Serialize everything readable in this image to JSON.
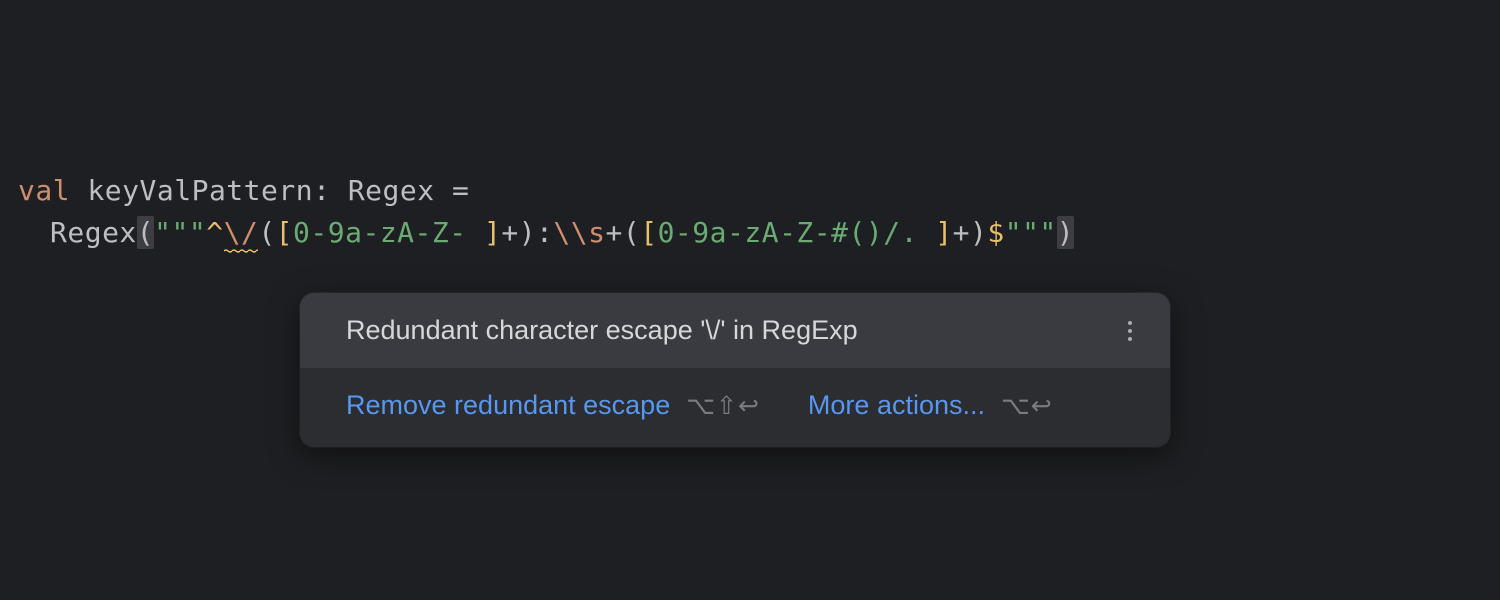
{
  "code": {
    "line1": {
      "keyword": "val",
      "identifier": "keyValPattern",
      "colon": ":",
      "type": "Regex",
      "eq": "="
    },
    "line2": {
      "func": "Regex",
      "open_paren": "(",
      "triple_quote_open": "\"\"\"",
      "caret": "^",
      "escape_slash": "\\/",
      "group1_open": "(",
      "class1_open": "[",
      "class1_content": "0-9a-zA-Z- ",
      "class1_close": "]",
      "plus1": "+",
      "group1_close": ")",
      "literal_colon": ":",
      "escape_s": "\\\\s",
      "plus2": "+",
      "group2_open": "(",
      "class2_open": "[",
      "class2_content": "0-9a-zA-Z-#()/. ",
      "class2_close": "]",
      "plus3": "+",
      "group2_close": ")",
      "dollar": "$",
      "triple_quote_close": "\"\"\"",
      "close_paren": ")"
    }
  },
  "tooltip": {
    "title": "Redundant character escape '\\/' in RegExp",
    "actions": {
      "fix": {
        "label": "Remove redundant escape",
        "shortcut": "⌥⇧↩"
      },
      "more": {
        "label": "More actions...",
        "shortcut": "⌥↩"
      }
    }
  }
}
